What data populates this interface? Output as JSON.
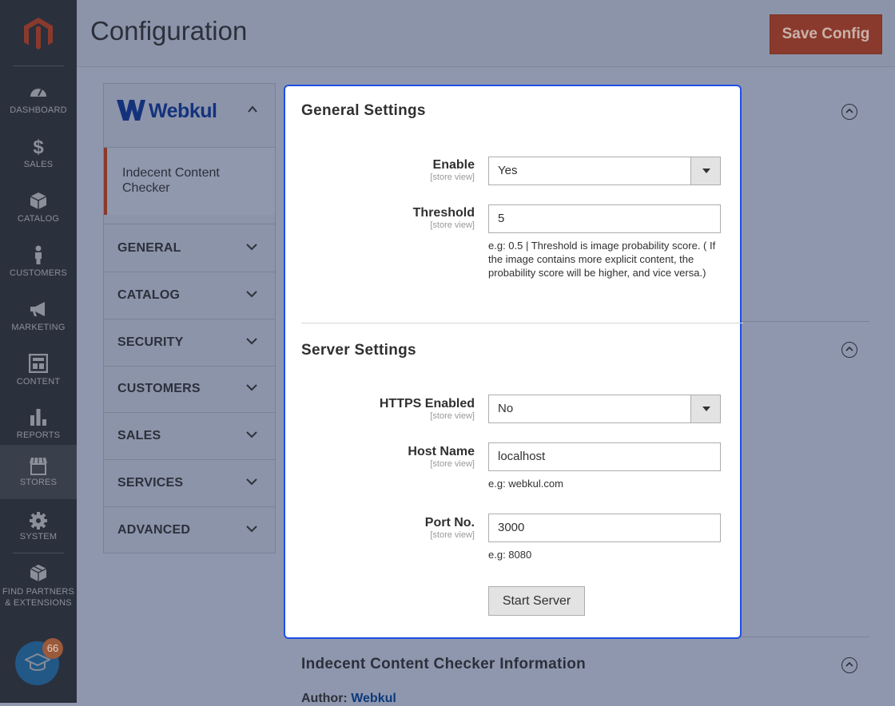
{
  "nav": {
    "items": [
      {
        "label": "DASHBOARD",
        "icon": "dashboard-icon"
      },
      {
        "label": "SALES",
        "icon": "dollar-icon"
      },
      {
        "label": "CATALOG",
        "icon": "box-icon"
      },
      {
        "label": "CUSTOMERS",
        "icon": "person-icon"
      },
      {
        "label": "MARKETING",
        "icon": "megaphone-icon"
      },
      {
        "label": "CONTENT",
        "icon": "layout-icon"
      },
      {
        "label": "REPORTS",
        "icon": "bar-chart-icon"
      },
      {
        "label": "STORES",
        "icon": "store-icon"
      },
      {
        "label": "SYSTEM",
        "icon": "gear-icon"
      }
    ],
    "partners_line1": "FIND PARTNERS",
    "partners_line2": "& EXTENSIONS",
    "badge_count": "66"
  },
  "header": {
    "title": "Configuration",
    "save_label": "Save Config"
  },
  "tabs": {
    "vendor": "Webkul",
    "vendor_item": "Indecent Content Checker",
    "items": [
      "GENERAL",
      "CATALOG",
      "SECURITY",
      "CUSTOMERS",
      "SALES",
      "SERVICES",
      "ADVANCED"
    ]
  },
  "general": {
    "title": "General Settings",
    "enable_label": "Enable",
    "enable_scope": "[store view]",
    "enable_value": "Yes",
    "threshold_label": "Threshold",
    "threshold_scope": "[store view]",
    "threshold_value": "5",
    "threshold_note": "e.g: 0.5 | Threshold is image probability score. ( If the image contains more explicit content, the probability score will be higher, and vice versa.)"
  },
  "server": {
    "title": "Server Settings",
    "https_label": "HTTPS Enabled",
    "https_scope": "[store view]",
    "https_value": "No",
    "host_label": "Host Name",
    "host_scope": "[store view]",
    "host_value": "localhost",
    "host_note": "e.g: webkul.com",
    "port_label": "Port No.",
    "port_scope": "[store view]",
    "port_value": "3000",
    "port_note": "e.g: 8080",
    "start_label": "Start Server"
  },
  "info": {
    "title": "Indecent Content Checker Information",
    "author_label": "Author:",
    "author_value": "Webkul"
  },
  "colors": {
    "accent": "#1e4ee8",
    "brand": "#eb5202",
    "save": "#8a3a2c"
  }
}
